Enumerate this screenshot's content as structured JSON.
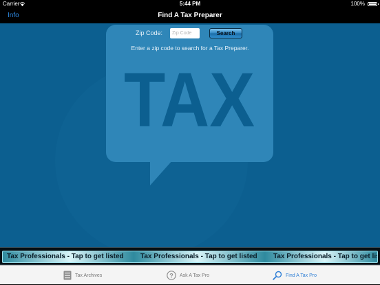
{
  "status_bar": {
    "carrier": "Carrier",
    "time": "5:44 PM",
    "battery": "100%"
  },
  "nav": {
    "info_label": "Info",
    "title": "Find A Tax Preparer"
  },
  "background": {
    "watermark_text": "TAX"
  },
  "search": {
    "label": "Zip Code:",
    "placeholder": "Zip Code",
    "value": "",
    "button_label": "Search",
    "hint": "Enter a zip code to search for a Tax Preparer."
  },
  "ticker": {
    "items": [
      "Tax Professionals - Tap to get listed",
      "Tax Professionals - Tap to get listed",
      "Tax Professionals - Tap to get listed"
    ]
  },
  "tabs": [
    {
      "label": "Tax Archives",
      "icon": "archive-box-icon",
      "active": false
    },
    {
      "label": "Ask A Tax Pro",
      "icon": "question-circle-icon",
      "active": false
    },
    {
      "label": "Find A Tax Pro",
      "icon": "magnifier-icon",
      "active": true
    }
  ],
  "colors": {
    "background": "#0c5f90",
    "accent": "#2f7fd6",
    "watermark": "#2f86b8"
  }
}
